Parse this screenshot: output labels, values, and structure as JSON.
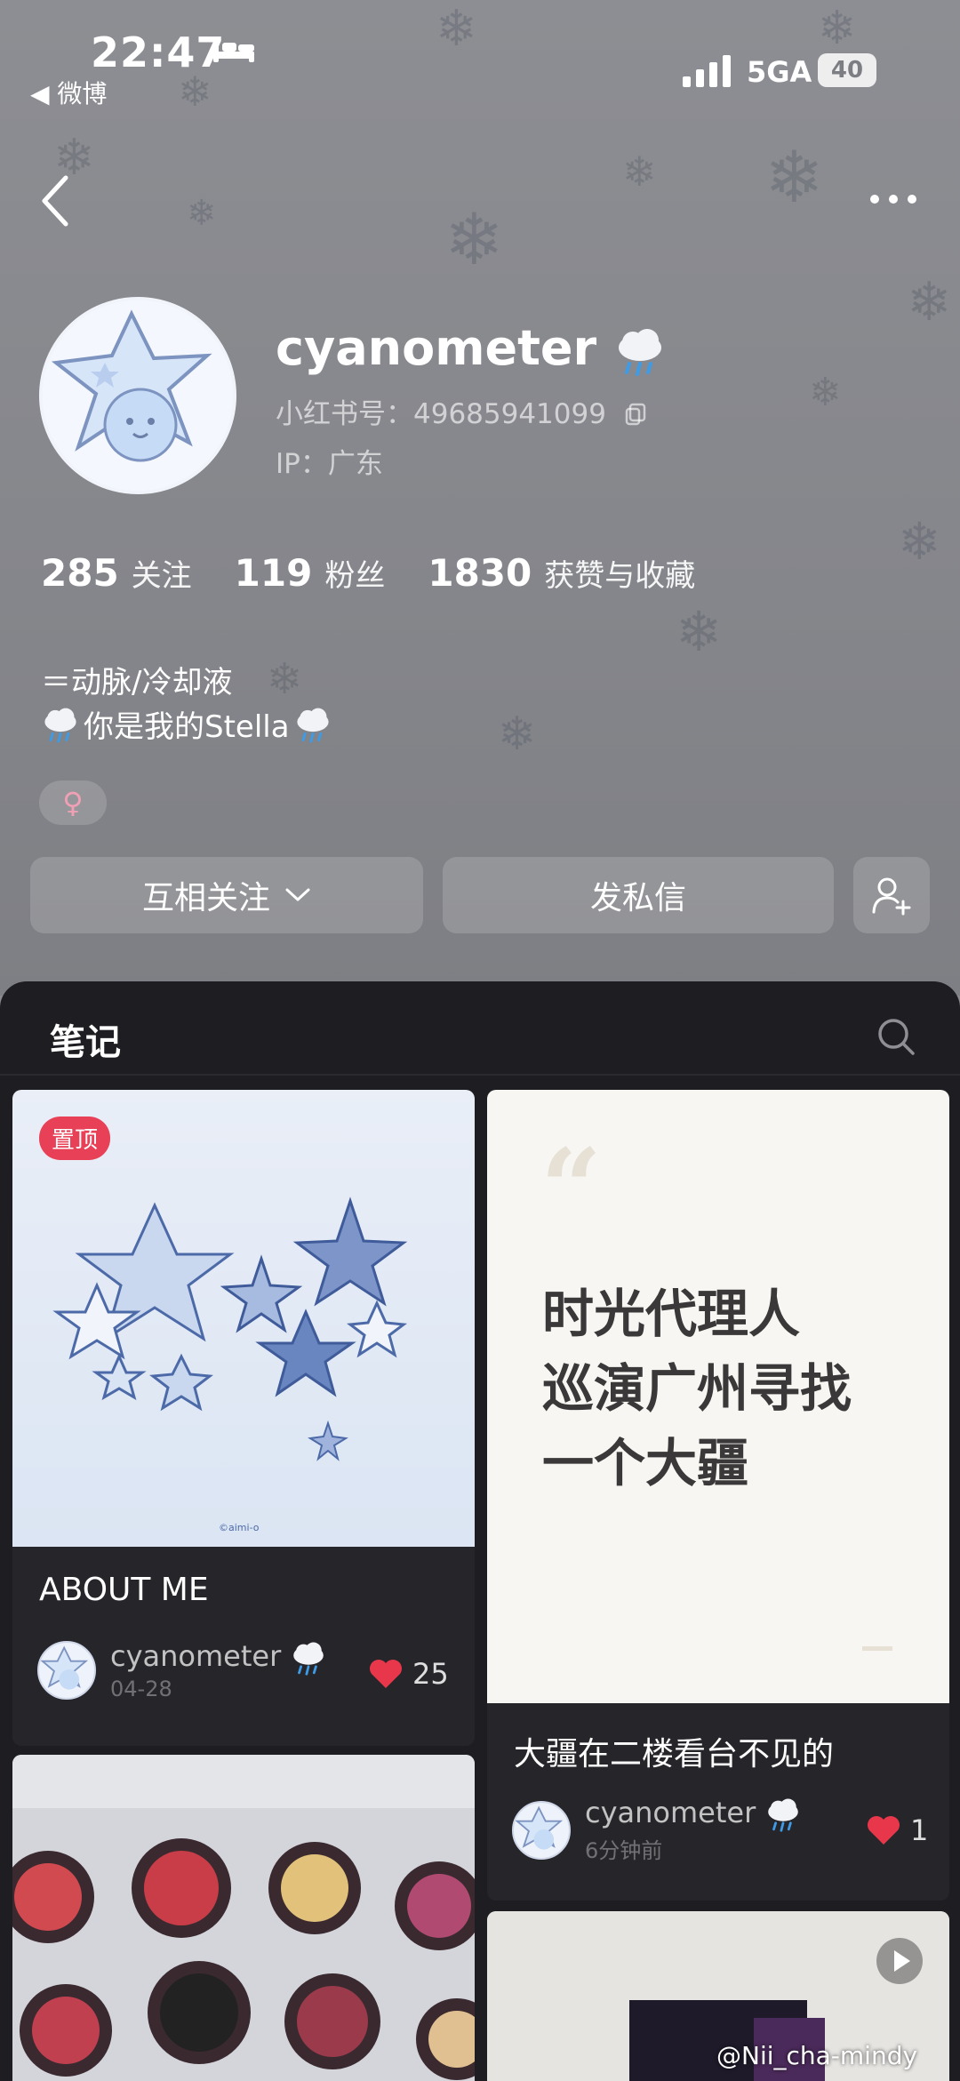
{
  "status_bar": {
    "time": "22:47",
    "back_app": "◀ 微博",
    "network": "5GA",
    "battery": "40"
  },
  "profile": {
    "username": "cyanometer",
    "xhs_id": "小红书号：49685941099",
    "ip": "IP：广东",
    "stats": [
      {
        "num": "285",
        "label": "关注"
      },
      {
        "num": "119",
        "label": "粉丝"
      },
      {
        "num": "1830",
        "label": "获赞与收藏"
      }
    ],
    "bio_line1": "＝动脉/冷却液",
    "bio_line2_text": "你是我的Stella",
    "gender": "♀"
  },
  "actions": {
    "follow_label": "互相关注",
    "message_label": "发私信"
  },
  "tabs": {
    "notes_label": "笔记"
  },
  "notes": [
    {
      "pin": "置顶",
      "title": "ABOUT ME",
      "author": "cyanometer",
      "date": "04-28",
      "likes": "25"
    },
    {
      "quote": [
        "时光代理人",
        "巡演广州寻找",
        "一个大疆"
      ],
      "title": "大疆在二楼看台不见的",
      "author": "cyanometer",
      "date": "6分钟前",
      "likes": "1"
    }
  ],
  "watermark": "@Nii_cha-mindy",
  "colors": {
    "panel_bg": "#1e1e22",
    "card_bg": "#25252a",
    "heart": "#e8374a",
    "pin_bg": "#e84057"
  }
}
